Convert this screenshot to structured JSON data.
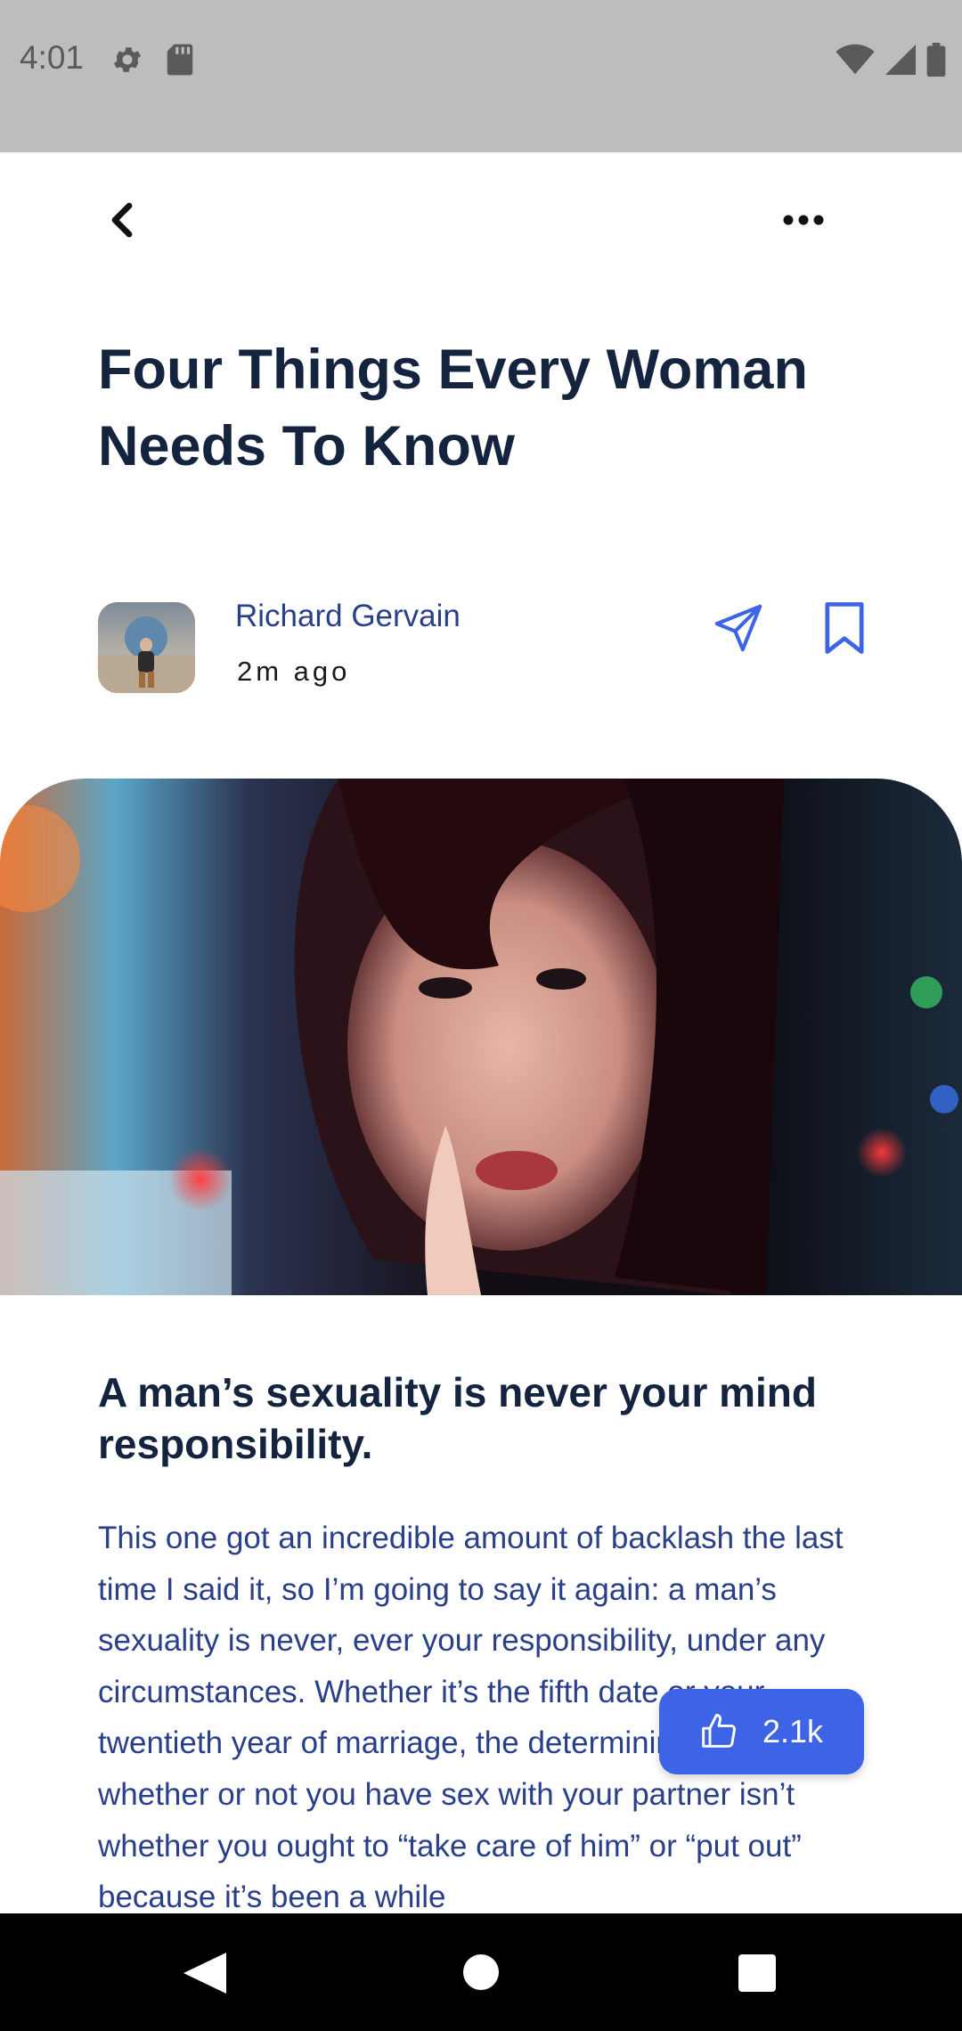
{
  "status_bar": {
    "time": "4:01",
    "left_icons": [
      "settings-icon",
      "sd-card-icon"
    ],
    "right_icons": [
      "wifi-icon",
      "cellular-signal-icon",
      "battery-icon"
    ]
  },
  "toolbar": {
    "back_icon": "chevron-left-icon",
    "more_icon": "more-horizontal-icon"
  },
  "article": {
    "title": "Four Things Every Woman Needs To Know",
    "author": {
      "name": "Richard Gervain",
      "time": "2m ago",
      "avatar_icon": "avatar-photo"
    },
    "actions": {
      "share_icon": "send-icon",
      "bookmark_icon": "bookmark-icon"
    },
    "hero_image": "woman-portrait-photo",
    "subheading": "A man’s sexuality is never your mind responsibility.",
    "body": "This one got an incredible amount of backlash the last time I said it, so I’m going to say it again: a man’s sexuality is never, ever your responsibility, under any circumstances. Whether it’s the fifth date or your twentieth year of marriage, the determining factor for whether or not you have sex with your partner isn’t whether you ought to “take care of him” or “put out” because it’s been a while"
  },
  "like": {
    "count": "2.1k",
    "icon": "thumbs-up-icon"
  },
  "colors": {
    "title": "#14233e",
    "body": "#2a3f8a",
    "accent": "#3d63e6",
    "status_bar": "#bdbdbd"
  }
}
